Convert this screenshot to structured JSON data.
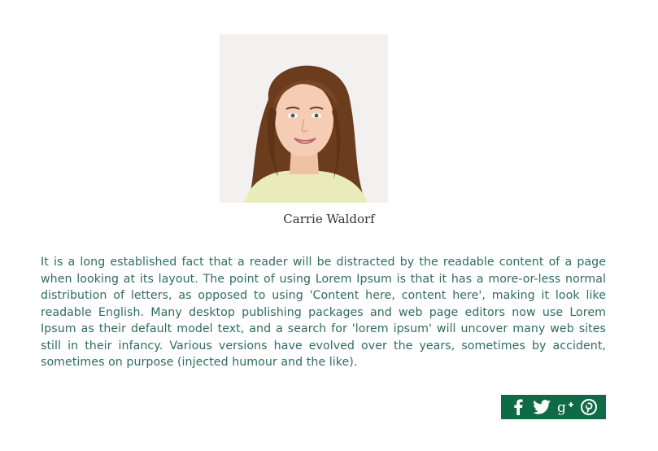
{
  "profile": {
    "name": "Carrie Waldorf",
    "bio": "It is a long established fact that a reader will be distracted by the readable content of a page when looking at its layout. The point of using Lorem Ipsum is that it has a more-or-less normal distribution of letters, as opposed to using 'Content here, content here', making it look like readable English. Many desktop publishing packages and web page editors now use Lorem Ipsum as their default model text, and a search for 'lorem ipsum' will uncover many web sites still in their infancy. Various versions have evolved over the years, sometimes by accident, sometimes on purpose (injected humour and the like)."
  },
  "social": {
    "bg_color": "#0e6b45",
    "icons": [
      "facebook-icon",
      "twitter-icon",
      "google-plus-icon",
      "pinterest-icon"
    ]
  },
  "colors": {
    "bio_text": "#2f6b63",
    "name_text": "#333333"
  }
}
